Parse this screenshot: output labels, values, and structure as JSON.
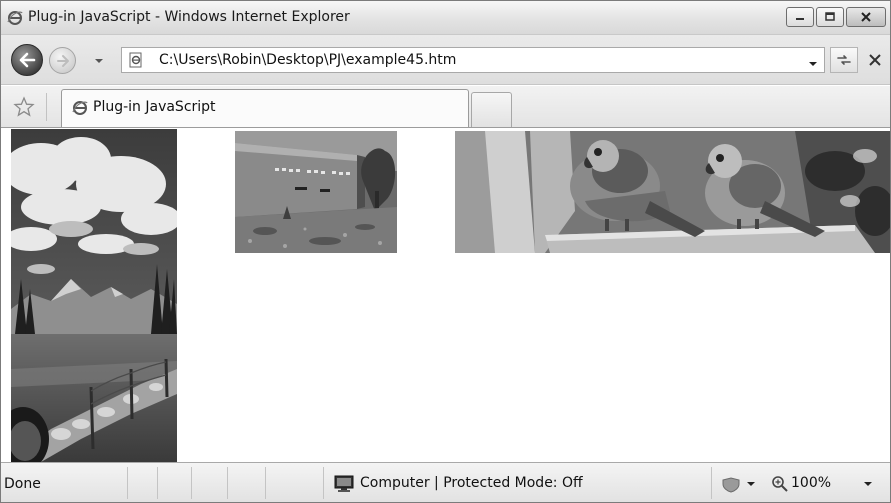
{
  "window": {
    "title": "Plug-in JavaScript - Windows Internet Explorer"
  },
  "address_bar": {
    "url": "C:\\Users\\Robin\\Desktop\\PJ\\example45.htm"
  },
  "tabs": [
    {
      "label": "Plug-in JavaScript",
      "active": true
    }
  ],
  "content": {
    "images": [
      {
        "subject": "mountain landscape with clouds, meadow and stone fence"
      },
      {
        "subject": "Death Valley Museum building",
        "sign_text": "DEATH VALLEY MUSEUM"
      },
      {
        "subject": "two parrots perched on a log"
      }
    ]
  },
  "status_bar": {
    "status": "Done",
    "zone": "Computer | Protected Mode: Off",
    "zoom": "100%"
  },
  "icons": {
    "title": "ie-logo-icon",
    "back": "back-arrow-icon",
    "forward": "forward-arrow-icon",
    "recent_pages": "chevron-down-icon",
    "page": "page-icon",
    "refresh": "refresh-icon",
    "stop": "close-icon",
    "favorites": "star-icon",
    "zone": "computer-icon",
    "security": "security-icon",
    "zoom": "zoom-icon"
  }
}
